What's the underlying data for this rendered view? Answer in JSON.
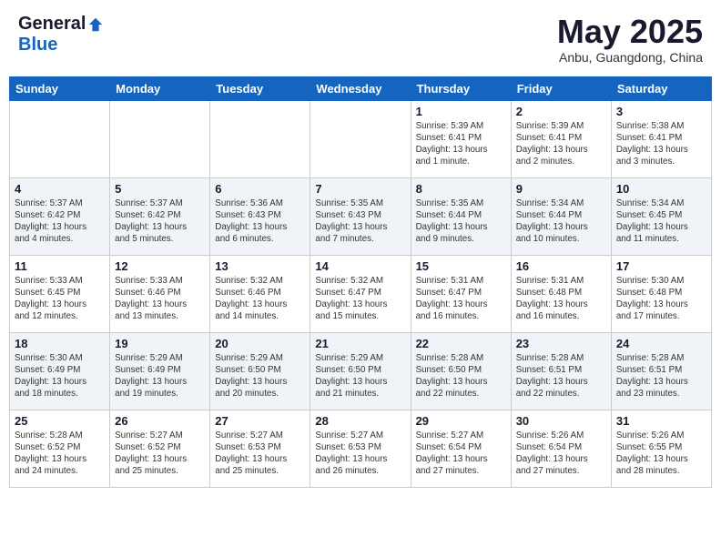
{
  "logo": {
    "general": "General",
    "blue": "Blue"
  },
  "title": "May 2025",
  "location": "Anbu, Guangdong, China",
  "weekdays": [
    "Sunday",
    "Monday",
    "Tuesday",
    "Wednesday",
    "Thursday",
    "Friday",
    "Saturday"
  ],
  "weeks": [
    [
      {
        "day": "",
        "info": ""
      },
      {
        "day": "",
        "info": ""
      },
      {
        "day": "",
        "info": ""
      },
      {
        "day": "",
        "info": ""
      },
      {
        "day": "1",
        "info": "Sunrise: 5:39 AM\nSunset: 6:41 PM\nDaylight: 13 hours\nand 1 minute."
      },
      {
        "day": "2",
        "info": "Sunrise: 5:39 AM\nSunset: 6:41 PM\nDaylight: 13 hours\nand 2 minutes."
      },
      {
        "day": "3",
        "info": "Sunrise: 5:38 AM\nSunset: 6:41 PM\nDaylight: 13 hours\nand 3 minutes."
      }
    ],
    [
      {
        "day": "4",
        "info": "Sunrise: 5:37 AM\nSunset: 6:42 PM\nDaylight: 13 hours\nand 4 minutes."
      },
      {
        "day": "5",
        "info": "Sunrise: 5:37 AM\nSunset: 6:42 PM\nDaylight: 13 hours\nand 5 minutes."
      },
      {
        "day": "6",
        "info": "Sunrise: 5:36 AM\nSunset: 6:43 PM\nDaylight: 13 hours\nand 6 minutes."
      },
      {
        "day": "7",
        "info": "Sunrise: 5:35 AM\nSunset: 6:43 PM\nDaylight: 13 hours\nand 7 minutes."
      },
      {
        "day": "8",
        "info": "Sunrise: 5:35 AM\nSunset: 6:44 PM\nDaylight: 13 hours\nand 9 minutes."
      },
      {
        "day": "9",
        "info": "Sunrise: 5:34 AM\nSunset: 6:44 PM\nDaylight: 13 hours\nand 10 minutes."
      },
      {
        "day": "10",
        "info": "Sunrise: 5:34 AM\nSunset: 6:45 PM\nDaylight: 13 hours\nand 11 minutes."
      }
    ],
    [
      {
        "day": "11",
        "info": "Sunrise: 5:33 AM\nSunset: 6:45 PM\nDaylight: 13 hours\nand 12 minutes."
      },
      {
        "day": "12",
        "info": "Sunrise: 5:33 AM\nSunset: 6:46 PM\nDaylight: 13 hours\nand 13 minutes."
      },
      {
        "day": "13",
        "info": "Sunrise: 5:32 AM\nSunset: 6:46 PM\nDaylight: 13 hours\nand 14 minutes."
      },
      {
        "day": "14",
        "info": "Sunrise: 5:32 AM\nSunset: 6:47 PM\nDaylight: 13 hours\nand 15 minutes."
      },
      {
        "day": "15",
        "info": "Sunrise: 5:31 AM\nSunset: 6:47 PM\nDaylight: 13 hours\nand 16 minutes."
      },
      {
        "day": "16",
        "info": "Sunrise: 5:31 AM\nSunset: 6:48 PM\nDaylight: 13 hours\nand 16 minutes."
      },
      {
        "day": "17",
        "info": "Sunrise: 5:30 AM\nSunset: 6:48 PM\nDaylight: 13 hours\nand 17 minutes."
      }
    ],
    [
      {
        "day": "18",
        "info": "Sunrise: 5:30 AM\nSunset: 6:49 PM\nDaylight: 13 hours\nand 18 minutes."
      },
      {
        "day": "19",
        "info": "Sunrise: 5:29 AM\nSunset: 6:49 PM\nDaylight: 13 hours\nand 19 minutes."
      },
      {
        "day": "20",
        "info": "Sunrise: 5:29 AM\nSunset: 6:50 PM\nDaylight: 13 hours\nand 20 minutes."
      },
      {
        "day": "21",
        "info": "Sunrise: 5:29 AM\nSunset: 6:50 PM\nDaylight: 13 hours\nand 21 minutes."
      },
      {
        "day": "22",
        "info": "Sunrise: 5:28 AM\nSunset: 6:50 PM\nDaylight: 13 hours\nand 22 minutes."
      },
      {
        "day": "23",
        "info": "Sunrise: 5:28 AM\nSunset: 6:51 PM\nDaylight: 13 hours\nand 22 minutes."
      },
      {
        "day": "24",
        "info": "Sunrise: 5:28 AM\nSunset: 6:51 PM\nDaylight: 13 hours\nand 23 minutes."
      }
    ],
    [
      {
        "day": "25",
        "info": "Sunrise: 5:28 AM\nSunset: 6:52 PM\nDaylight: 13 hours\nand 24 minutes."
      },
      {
        "day": "26",
        "info": "Sunrise: 5:27 AM\nSunset: 6:52 PM\nDaylight: 13 hours\nand 25 minutes."
      },
      {
        "day": "27",
        "info": "Sunrise: 5:27 AM\nSunset: 6:53 PM\nDaylight: 13 hours\nand 25 minutes."
      },
      {
        "day": "28",
        "info": "Sunrise: 5:27 AM\nSunset: 6:53 PM\nDaylight: 13 hours\nand 26 minutes."
      },
      {
        "day": "29",
        "info": "Sunrise: 5:27 AM\nSunset: 6:54 PM\nDaylight: 13 hours\nand 27 minutes."
      },
      {
        "day": "30",
        "info": "Sunrise: 5:26 AM\nSunset: 6:54 PM\nDaylight: 13 hours\nand 27 minutes."
      },
      {
        "day": "31",
        "info": "Sunrise: 5:26 AM\nSunset: 6:55 PM\nDaylight: 13 hours\nand 28 minutes."
      }
    ]
  ]
}
